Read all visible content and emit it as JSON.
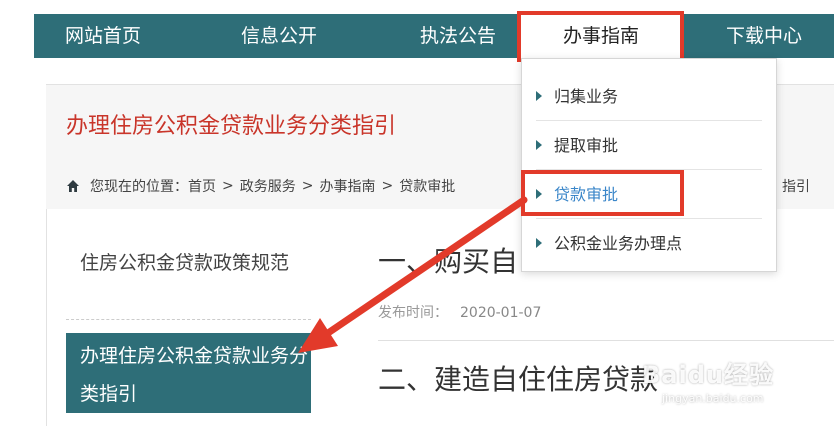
{
  "nav": {
    "items": [
      {
        "label": "网站首页"
      },
      {
        "label": "信息公开"
      },
      {
        "label": "执法公告"
      },
      {
        "label": "办事指南"
      },
      {
        "label": "下载中心"
      }
    ],
    "active_index": 3
  },
  "page": {
    "title": "办理住房公积金贷款业务分类指引"
  },
  "breadcrumb": {
    "prefix": "您现在的位置：",
    "items": [
      "首页",
      "政务服务",
      "办事指南",
      "贷款审批"
    ],
    "separator": ">",
    "tail_fragment": "指引"
  },
  "sidebar": {
    "items": [
      {
        "label": "住房公积金贷款政策规范"
      },
      {
        "label": "办理住房公积金贷款业务分类指引"
      }
    ]
  },
  "articles": {
    "first_title": "一、购买自",
    "publish_label": "发布时间：",
    "publish_date": "2020-01-07",
    "second_title": "二、建造自住住房贷款"
  },
  "dropdown": {
    "items": [
      {
        "label": "归集业务"
      },
      {
        "label": "提取审批"
      },
      {
        "label": "贷款审批"
      },
      {
        "label": "公积金业务办理点"
      }
    ],
    "selected_index": 2
  },
  "watermark": {
    "logo": "Baidu经验",
    "url": "jingyan.baidu.com"
  },
  "colors": {
    "primary": "#2e6e78",
    "title_red": "#c9352a",
    "annotation_red": "#e23a2a",
    "link_blue": "#3a86c9"
  }
}
